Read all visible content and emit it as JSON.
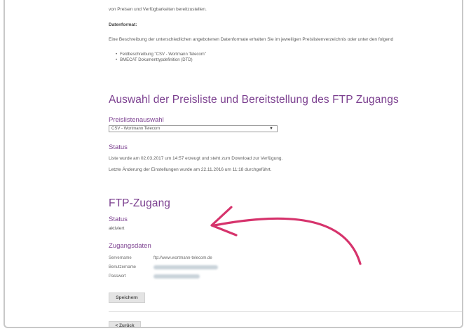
{
  "intro": {
    "line1": "von Preisen und Verfügbarkeiten bereitzustellen.",
    "format_heading": "Datenformat:",
    "format_text": "Eine Beschreibung der unterschiedlichen angebotenen Datenformate erhalten Sie im jeweiligen Preislistenverzeichnis oder unter den folgend",
    "format_items": [
      "Feldbeschreibung \"CSV - Wortmann Telecom\"",
      "BMECAT Dokumenttypdefinition (DTD)"
    ]
  },
  "pricelist_section": {
    "title": "Auswahl der Preisliste und Bereitstellung des FTP Zugangs",
    "select_heading": "Preislistenauswahl",
    "select_value": "CSV - Wortmann Telecom",
    "status_heading": "Status",
    "status_line1": "Liste wurde am 02.03.2017 um 14:57 erzeugt und steht zum Download zur Verfügung.",
    "status_line2": "Letzte Änderung der Einstellungen wurde am 22.11.2016 um 11:18 durchgeführt."
  },
  "ftp_section": {
    "title": "FTP-Zugang",
    "status_heading": "Status",
    "status_value": "aktiviert",
    "credentials_heading": "Zugangsdaten",
    "server_label": "Servername",
    "server_value": "ftp://www.wortmann-telecom.de",
    "user_label": "Benutzername",
    "password_label": "Passwort"
  },
  "buttons": {
    "save_label": "Speichern",
    "back_label": "< Zurück"
  },
  "colors": {
    "heading_purple": "#7b3f8f",
    "annotation_pink": "#d6336c"
  }
}
